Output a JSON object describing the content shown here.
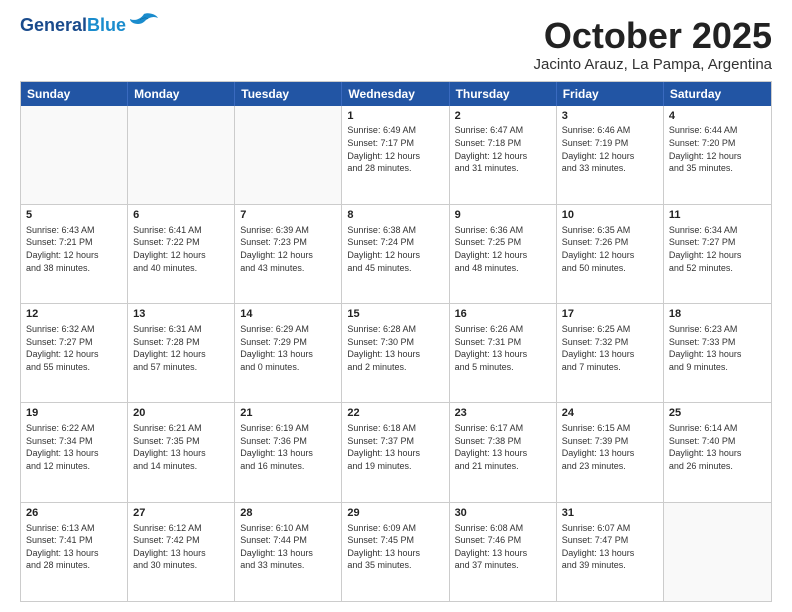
{
  "header": {
    "logo_line1": "General",
    "logo_line2": "Blue",
    "month": "October 2025",
    "location": "Jacinto Arauz, La Pampa, Argentina"
  },
  "days_of_week": [
    "Sunday",
    "Monday",
    "Tuesday",
    "Wednesday",
    "Thursday",
    "Friday",
    "Saturday"
  ],
  "weeks": [
    [
      {
        "day": "",
        "info": ""
      },
      {
        "day": "",
        "info": ""
      },
      {
        "day": "",
        "info": ""
      },
      {
        "day": "1",
        "info": "Sunrise: 6:49 AM\nSunset: 7:17 PM\nDaylight: 12 hours\nand 28 minutes."
      },
      {
        "day": "2",
        "info": "Sunrise: 6:47 AM\nSunset: 7:18 PM\nDaylight: 12 hours\nand 31 minutes."
      },
      {
        "day": "3",
        "info": "Sunrise: 6:46 AM\nSunset: 7:19 PM\nDaylight: 12 hours\nand 33 minutes."
      },
      {
        "day": "4",
        "info": "Sunrise: 6:44 AM\nSunset: 7:20 PM\nDaylight: 12 hours\nand 35 minutes."
      }
    ],
    [
      {
        "day": "5",
        "info": "Sunrise: 6:43 AM\nSunset: 7:21 PM\nDaylight: 12 hours\nand 38 minutes."
      },
      {
        "day": "6",
        "info": "Sunrise: 6:41 AM\nSunset: 7:22 PM\nDaylight: 12 hours\nand 40 minutes."
      },
      {
        "day": "7",
        "info": "Sunrise: 6:39 AM\nSunset: 7:23 PM\nDaylight: 12 hours\nand 43 minutes."
      },
      {
        "day": "8",
        "info": "Sunrise: 6:38 AM\nSunset: 7:24 PM\nDaylight: 12 hours\nand 45 minutes."
      },
      {
        "day": "9",
        "info": "Sunrise: 6:36 AM\nSunset: 7:25 PM\nDaylight: 12 hours\nand 48 minutes."
      },
      {
        "day": "10",
        "info": "Sunrise: 6:35 AM\nSunset: 7:26 PM\nDaylight: 12 hours\nand 50 minutes."
      },
      {
        "day": "11",
        "info": "Sunrise: 6:34 AM\nSunset: 7:27 PM\nDaylight: 12 hours\nand 52 minutes."
      }
    ],
    [
      {
        "day": "12",
        "info": "Sunrise: 6:32 AM\nSunset: 7:27 PM\nDaylight: 12 hours\nand 55 minutes."
      },
      {
        "day": "13",
        "info": "Sunrise: 6:31 AM\nSunset: 7:28 PM\nDaylight: 12 hours\nand 57 minutes."
      },
      {
        "day": "14",
        "info": "Sunrise: 6:29 AM\nSunset: 7:29 PM\nDaylight: 13 hours\nand 0 minutes."
      },
      {
        "day": "15",
        "info": "Sunrise: 6:28 AM\nSunset: 7:30 PM\nDaylight: 13 hours\nand 2 minutes."
      },
      {
        "day": "16",
        "info": "Sunrise: 6:26 AM\nSunset: 7:31 PM\nDaylight: 13 hours\nand 5 minutes."
      },
      {
        "day": "17",
        "info": "Sunrise: 6:25 AM\nSunset: 7:32 PM\nDaylight: 13 hours\nand 7 minutes."
      },
      {
        "day": "18",
        "info": "Sunrise: 6:23 AM\nSunset: 7:33 PM\nDaylight: 13 hours\nand 9 minutes."
      }
    ],
    [
      {
        "day": "19",
        "info": "Sunrise: 6:22 AM\nSunset: 7:34 PM\nDaylight: 13 hours\nand 12 minutes."
      },
      {
        "day": "20",
        "info": "Sunrise: 6:21 AM\nSunset: 7:35 PM\nDaylight: 13 hours\nand 14 minutes."
      },
      {
        "day": "21",
        "info": "Sunrise: 6:19 AM\nSunset: 7:36 PM\nDaylight: 13 hours\nand 16 minutes."
      },
      {
        "day": "22",
        "info": "Sunrise: 6:18 AM\nSunset: 7:37 PM\nDaylight: 13 hours\nand 19 minutes."
      },
      {
        "day": "23",
        "info": "Sunrise: 6:17 AM\nSunset: 7:38 PM\nDaylight: 13 hours\nand 21 minutes."
      },
      {
        "day": "24",
        "info": "Sunrise: 6:15 AM\nSunset: 7:39 PM\nDaylight: 13 hours\nand 23 minutes."
      },
      {
        "day": "25",
        "info": "Sunrise: 6:14 AM\nSunset: 7:40 PM\nDaylight: 13 hours\nand 26 minutes."
      }
    ],
    [
      {
        "day": "26",
        "info": "Sunrise: 6:13 AM\nSunset: 7:41 PM\nDaylight: 13 hours\nand 28 minutes."
      },
      {
        "day": "27",
        "info": "Sunrise: 6:12 AM\nSunset: 7:42 PM\nDaylight: 13 hours\nand 30 minutes."
      },
      {
        "day": "28",
        "info": "Sunrise: 6:10 AM\nSunset: 7:44 PM\nDaylight: 13 hours\nand 33 minutes."
      },
      {
        "day": "29",
        "info": "Sunrise: 6:09 AM\nSunset: 7:45 PM\nDaylight: 13 hours\nand 35 minutes."
      },
      {
        "day": "30",
        "info": "Sunrise: 6:08 AM\nSunset: 7:46 PM\nDaylight: 13 hours\nand 37 minutes."
      },
      {
        "day": "31",
        "info": "Sunrise: 6:07 AM\nSunset: 7:47 PM\nDaylight: 13 hours\nand 39 minutes."
      },
      {
        "day": "",
        "info": ""
      }
    ]
  ]
}
